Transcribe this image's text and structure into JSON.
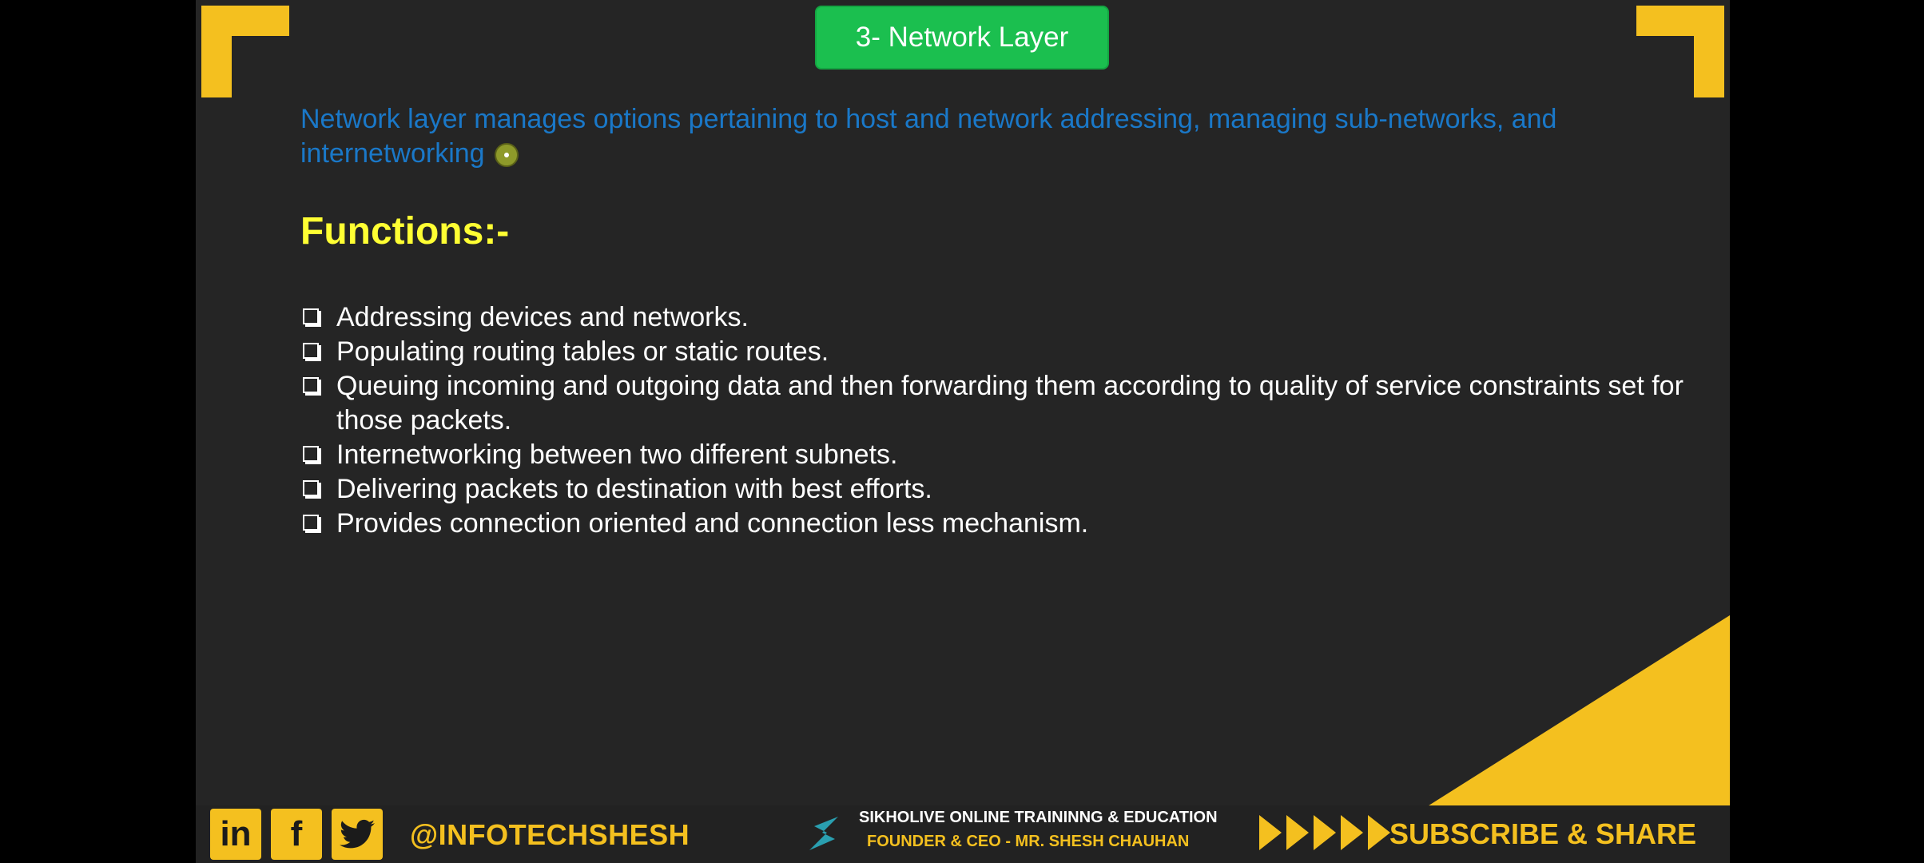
{
  "slide": {
    "title": "3- Network Layer",
    "intro": "Network layer manages options pertaining to host and network addressing, managing sub-networks, and internetworking",
    "functions_heading": "Functions:-",
    "functions": [
      "Addressing devices and networks.",
      "Populating routing tables or static routes.",
      "Queuing incoming and outgoing data and then forwarding them according to quality of service constraints set for those packets.",
      "Internetworking between two different subnets.",
      "Delivering packets to destination with best efforts.",
      "Provides connection oriented and connection less mechanism."
    ]
  },
  "footer": {
    "social_icons": [
      "linkedin-icon",
      "facebook-icon",
      "twitter-icon"
    ],
    "linkedin_label": "in",
    "facebook_label": "f",
    "handle": "@INFOTECHSHESH",
    "org_name": "SIKHOLIVE ONLINE TRAININNG & EDUCATION",
    "founder": "FOUNDER & CEO - MR. SHESH CHAUHAN",
    "cta": "SUBSCRIBE & SHARE"
  },
  "colors": {
    "accent": "#f4c01f",
    "title_badge": "#1bbf4f",
    "intro_text": "#1a78c8",
    "heading": "#ffff33",
    "background": "#252525"
  }
}
